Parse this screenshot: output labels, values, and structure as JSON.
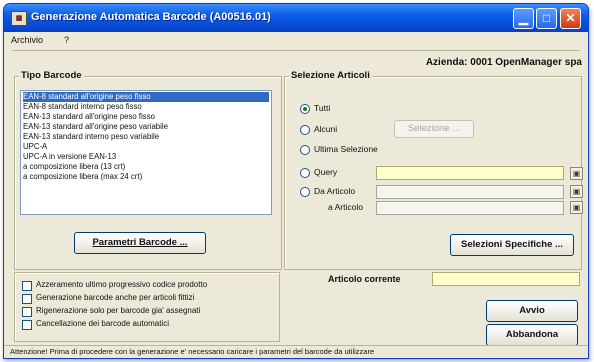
{
  "window": {
    "title": "Generazione Automatica Barcode  (A00516.01)"
  },
  "menu": [
    {
      "label": "Archivio"
    },
    {
      "label": "?"
    }
  ],
  "azienda": "Azienda: 0001 OpenManager spa",
  "tipo_barcode": {
    "label": "Tipo Barcode",
    "items": [
      "EAN-8    standard all'origine peso fisso",
      "EAN-8    standard interno    peso fisso",
      "EAN-13 standard all'origine peso fisso",
      "EAN-13 standard all'origine peso variabile",
      "EAN-13 standard interno    peso variabile",
      "UPC-A",
      "UPC-A  in versione EAN-13",
      "a composizione libera (13 crt)",
      "a composizione libera (max 24 crt)"
    ],
    "selected_index": 0,
    "parametri_button": "Parametri Barcode ..."
  },
  "selezione_articoli": {
    "label": "Selezione Articoli",
    "options": [
      "Tutti",
      "Alcuni",
      "Ultima Selezione",
      "Query",
      "Da  Articolo"
    ],
    "selected_index": 0,
    "a_articolo_label": "a  Articolo",
    "selezione_button": "Selezione ...",
    "specifiche_button": "Selezioni Specifiche ..."
  },
  "articolo_corrente_label": "Articolo corrente",
  "options_checkboxes": [
    "Azzeramento ultimo progressivo codice prodotto",
    "Generazione barcode anche per articoli fittizi",
    "Rigenerazione solo per barcode gia' assegnati",
    "Cancellazione dei barcode automatici"
  ],
  "buttons": {
    "avvio": "Avvio",
    "abbandona": "Abbandona"
  },
  "status_text": "Attenzione! Prima di procedere con la generazione e' necessario caricare i parametri del barcode da utilizzare",
  "colors": {
    "titlebar": "#0a5ee8",
    "selection": "#316ac5",
    "field_yellow": "#ffffcc",
    "window_bg": "#ece9d8"
  },
  "icons": {
    "picker": "lookup-icon",
    "close": "close-icon"
  }
}
